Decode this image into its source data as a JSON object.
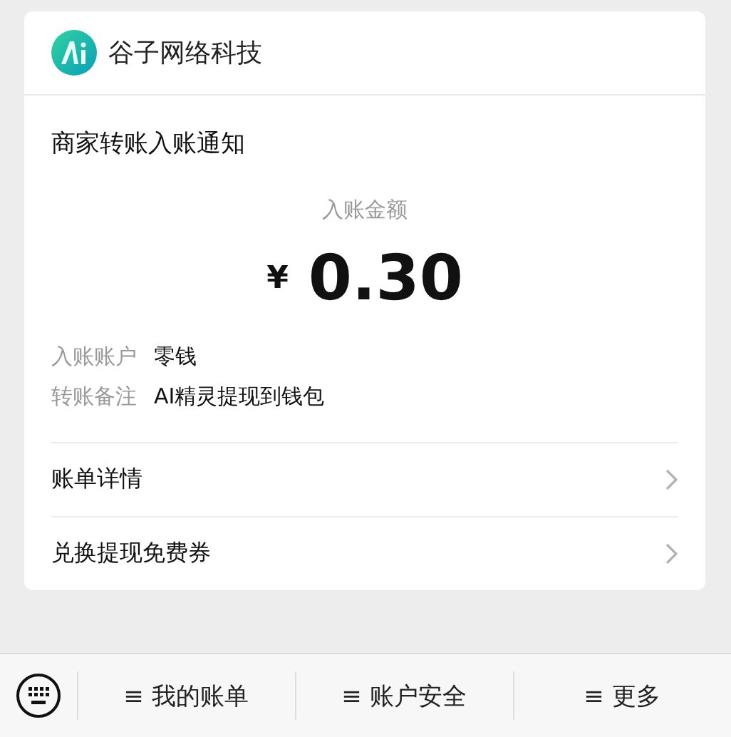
{
  "account": {
    "name": "谷子网络科技"
  },
  "notice": {
    "title": "商家转账入账通知",
    "amount_label": "入账金额",
    "currency": "¥",
    "amount": "0.30",
    "details": [
      {
        "label": "入账账户",
        "value": "零钱"
      },
      {
        "label": "转账备注",
        "value": "AI精灵提现到钱包"
      }
    ],
    "links": [
      {
        "label": "账单详情"
      },
      {
        "label": "兑换提现免费券"
      }
    ]
  },
  "menu_bar": {
    "items": [
      {
        "label": "≡ 我的账单"
      },
      {
        "label": "≡ 账户安全"
      },
      {
        "label": "≡ 更多"
      }
    ]
  }
}
